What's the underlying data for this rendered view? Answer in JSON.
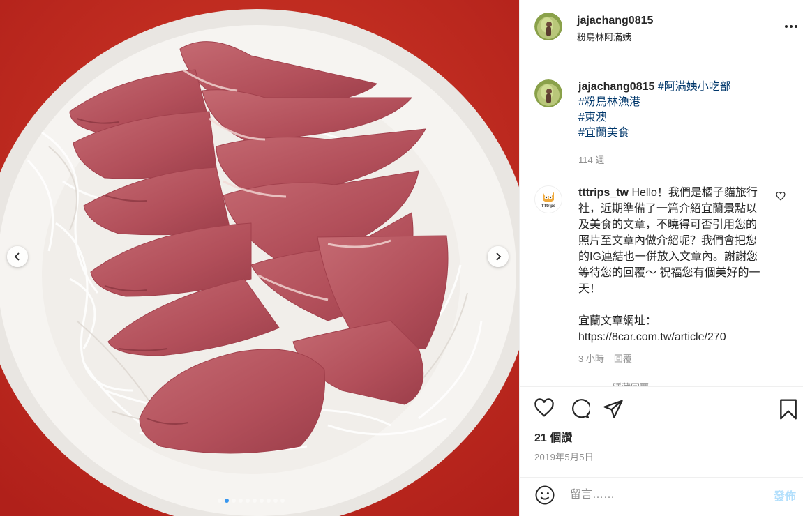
{
  "post": {
    "username": "jajachang0815",
    "location": "粉鳥林阿滿姨",
    "caption": {
      "hashtags": [
        "#阿滿姨小吃部",
        "#粉鳥林漁港",
        "#東澳",
        "#宜蘭美食"
      ],
      "time": "114 週"
    },
    "likes": "21 個讚",
    "date": "2019年5月5日"
  },
  "comment": {
    "username": "tttrips_tw",
    "avatar_text": "TTtrips",
    "text": "Hello！我們是橘子貓旅行社，近期準備了一篇介紹宜蘭景點以及美食的文章，不曉得可否引用您的照片至文章內做介紹呢？我們會把您的IG連結也一併放入文章內。謝謝您 等待您的回覆～ 祝福您有個美好的一天！",
    "link_label": "宜蘭文章網址：",
    "link": "https://8car.com.tw/article/270",
    "time": "3 小時",
    "reply_label": "回覆",
    "view_replies": "隱藏回覆"
  },
  "add_comment": {
    "placeholder": "留言……",
    "post_label": "發佈"
  },
  "carousel": {
    "count": 10,
    "active": 1
  },
  "icons": [
    "more-options-icon",
    "heart-icon",
    "comment-icon",
    "share-icon",
    "bookmark-icon",
    "emoji-icon",
    "chevron-left-icon",
    "chevron-right-icon"
  ],
  "colors": {
    "link": "#00376b",
    "muted": "#8e8e8e",
    "accent": "#3897f0",
    "post_button": "#b2dffc"
  }
}
